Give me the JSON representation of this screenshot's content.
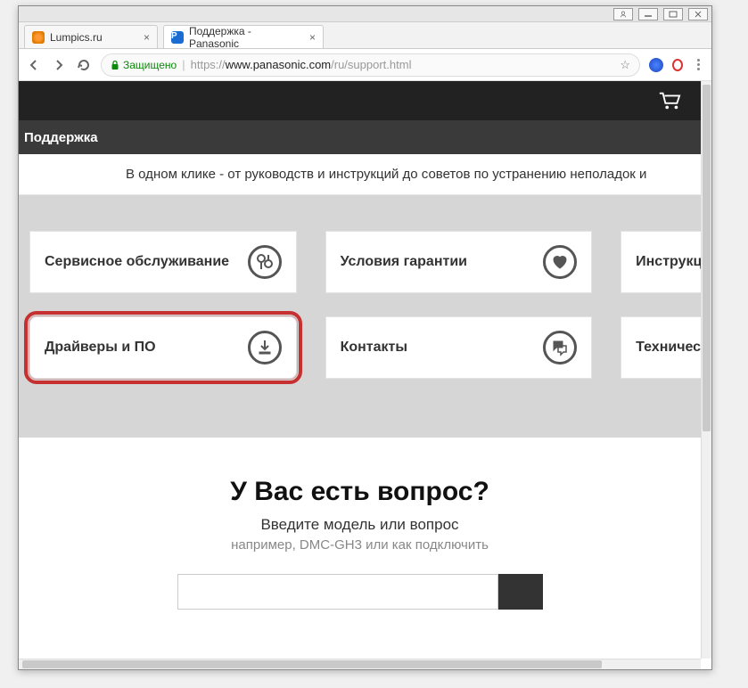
{
  "window": {
    "tabs": [
      {
        "title": "Lumpics.ru",
        "active": false
      },
      {
        "title": "Поддержка - Panasonic",
        "active": true,
        "favicon_letter": "P"
      }
    ],
    "secure_label": "Защищено",
    "url_proto": "https://",
    "url_host": "www.panasonic.com",
    "url_path": "/ru/support.html"
  },
  "header": {
    "section_title": "Поддержка",
    "intro_text": "В одном клике - от руководств и инструкций до советов по устранению неполадок и"
  },
  "tiles": {
    "row1": [
      {
        "label": "Сервисное обслуживание",
        "icon": "wrench"
      },
      {
        "label": "Условия гарантии",
        "icon": "heart"
      },
      {
        "label": "Инструкц",
        "icon": "",
        "cut": true
      }
    ],
    "row2": [
      {
        "label": "Драйверы и ПО",
        "icon": "download",
        "highlight": true
      },
      {
        "label": "Контакты",
        "icon": "chat"
      },
      {
        "label": "Техничес",
        "icon": "",
        "cut": true
      }
    ]
  },
  "question": {
    "heading": "У Вас есть вопрос?",
    "prompt": "Введите модель или вопрос",
    "example": "например, DMC-GH3 или как подключить"
  }
}
